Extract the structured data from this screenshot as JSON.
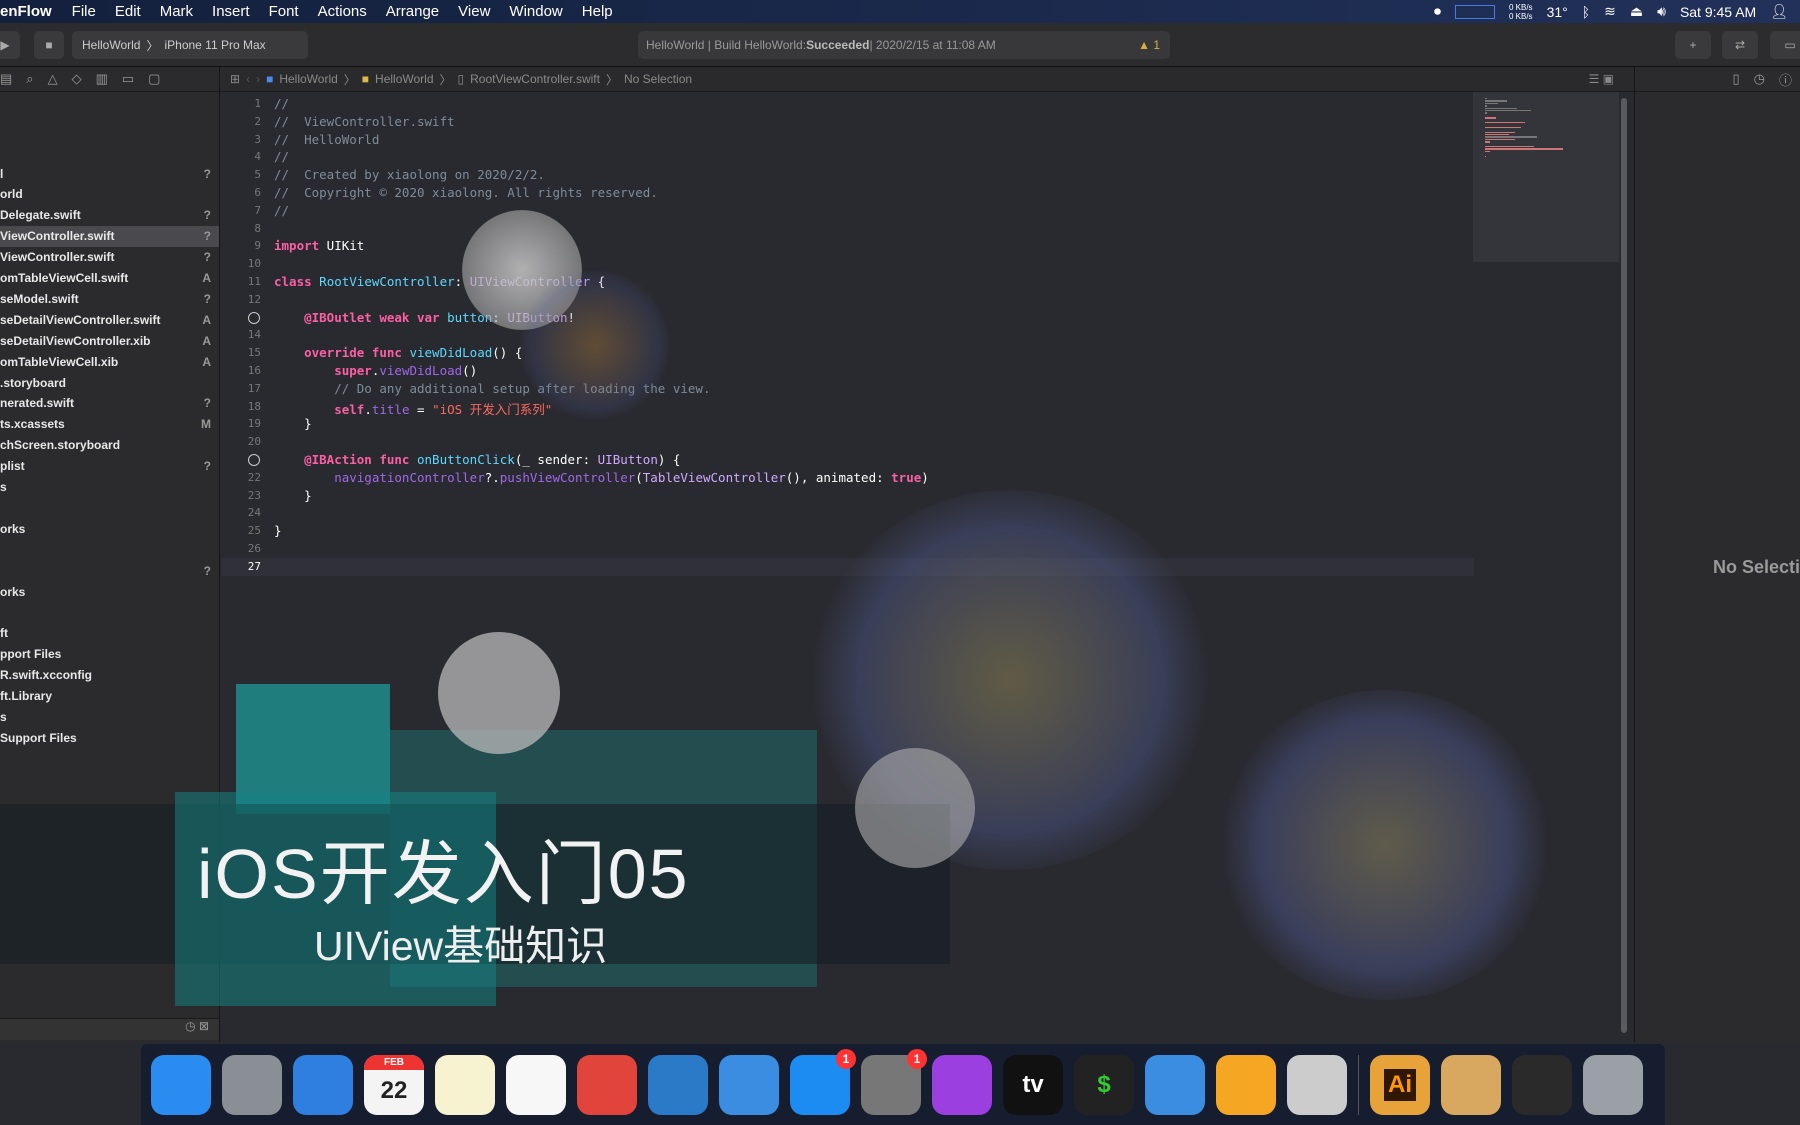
{
  "menubar": {
    "app": "enFlow",
    "items": [
      "File",
      "Edit",
      "Mark",
      "Insert",
      "Font",
      "Actions",
      "Arrange",
      "View",
      "Window",
      "Help"
    ],
    "status": {
      "net_up": "0 KB/s",
      "net_down": "0 KB/s",
      "temp": "31°",
      "clock": "Sat 9:45 AM"
    }
  },
  "toolbar": {
    "scheme": "HelloWorld",
    "device": "iPhone 11 Pro Max",
    "activity_prefix": "HelloWorld | Build HelloWorld: ",
    "activity_status": "Succeeded",
    "activity_suffix": " | 2020/2/15 at 11:08 AM",
    "warnings": "1"
  },
  "breadcrumb": [
    "HelloWorld",
    "HelloWorld",
    "RootViewController.swift",
    "No Selection"
  ],
  "navigator": {
    "files": [
      {
        "name": "l",
        "status": "?"
      },
      {
        "name": "orld",
        "status": ""
      },
      {
        "name": "Delegate.swift",
        "status": "?"
      },
      {
        "name": "ViewController.swift",
        "status": "?",
        "selected": true
      },
      {
        "name": "ViewController.swift",
        "status": "?"
      },
      {
        "name": "omTableViewCell.swift",
        "status": "A"
      },
      {
        "name": "seModel.swift",
        "status": "?"
      },
      {
        "name": "seDetailViewController.swift",
        "status": "A"
      },
      {
        "name": "seDetailViewController.xib",
        "status": "A"
      },
      {
        "name": "omTableViewCell.xib",
        "status": "A"
      },
      {
        "name": ".storyboard",
        "status": ""
      },
      {
        "name": "nerated.swift",
        "status": "?"
      },
      {
        "name": "ts.xcassets",
        "status": "M"
      },
      {
        "name": "chScreen.storyboard",
        "status": ""
      },
      {
        "name": "plist",
        "status": "?"
      },
      {
        "name": "s",
        "status": ""
      },
      {
        "name": "",
        "status": ""
      },
      {
        "name": "orks",
        "status": ""
      },
      {
        "name": "",
        "status": ""
      },
      {
        "name": "",
        "status": "?"
      },
      {
        "name": "orks",
        "status": ""
      },
      {
        "name": "",
        "status": ""
      },
      {
        "name": "ft",
        "status": ""
      },
      {
        "name": "pport Files",
        "status": ""
      },
      {
        "name": "R.swift.xcconfig",
        "status": ""
      },
      {
        "name": "ft.Library",
        "status": ""
      },
      {
        "name": "s",
        "status": ""
      },
      {
        "name": " Support Files",
        "status": ""
      }
    ]
  },
  "editor": {
    "current_line": 27,
    "breakpoint_lines": [
      13,
      21
    ],
    "lines": [
      [
        [
          "//",
          "comment"
        ]
      ],
      [
        [
          "//  ViewController.swift",
          "comment"
        ]
      ],
      [
        [
          "//  HelloWorld",
          "comment"
        ]
      ],
      [
        [
          "//",
          "comment"
        ]
      ],
      [
        [
          "//  Created by xiaolong on 2020/2/2.",
          "comment"
        ]
      ],
      [
        [
          "//  Copyright © 2020 xiaolong. All rights reserved.",
          "comment"
        ]
      ],
      [
        [
          "//",
          "comment"
        ]
      ],
      [],
      [
        [
          "import",
          "kw"
        ],
        [
          " UIKit",
          "plain"
        ]
      ],
      [],
      [
        [
          "class",
          "kw"
        ],
        [
          " ",
          "plain"
        ],
        [
          "RootViewController",
          "decl"
        ],
        [
          ": ",
          "plain"
        ],
        [
          "UIViewController",
          "type"
        ],
        [
          " {",
          "plain"
        ]
      ],
      [],
      [
        [
          "    @IBOutlet weak var",
          "kw"
        ],
        [
          " ",
          "plain"
        ],
        [
          "button",
          "decl"
        ],
        [
          ": ",
          "plain"
        ],
        [
          "UIButton",
          "type"
        ],
        [
          "!",
          "plain"
        ]
      ],
      [],
      [
        [
          "    override func",
          "kw"
        ],
        [
          " ",
          "plain"
        ],
        [
          "viewDidLoad",
          "decl"
        ],
        [
          "() {",
          "plain"
        ]
      ],
      [
        [
          "        super",
          "kw"
        ],
        [
          ".",
          "plain"
        ],
        [
          "viewDidLoad",
          "purple"
        ],
        [
          "()",
          "plain"
        ]
      ],
      [
        [
          "        // Do any additional setup after loading the view.",
          "comment"
        ]
      ],
      [
        [
          "        self",
          "kw"
        ],
        [
          ".",
          "plain"
        ],
        [
          "title",
          "purple"
        ],
        [
          " = ",
          "plain"
        ],
        [
          "\"iOS 开发入门系列\"",
          "str"
        ]
      ],
      [
        [
          "    }",
          "plain"
        ]
      ],
      [],
      [
        [
          "    @IBAction func",
          "kw"
        ],
        [
          " ",
          "plain"
        ],
        [
          "onButtonClick",
          "decl"
        ],
        [
          "(_ sender: ",
          "plain"
        ],
        [
          "UIButton",
          "type"
        ],
        [
          ") {",
          "plain"
        ]
      ],
      [
        [
          "        navigationController",
          "purple"
        ],
        [
          "?.",
          "plain"
        ],
        [
          "pushViewController",
          "purple"
        ],
        [
          "(",
          "plain"
        ],
        [
          "TableViewController",
          "type"
        ],
        [
          "(), animated: ",
          "plain"
        ],
        [
          "true",
          "kw"
        ],
        [
          ")",
          "plain"
        ]
      ],
      [
        [
          "    }",
          "plain"
        ]
      ],
      [],
      [
        [
          "}",
          "plain"
        ]
      ],
      [],
      []
    ]
  },
  "inspector": {
    "empty_label": "No Selection"
  },
  "overlay": {
    "title": "iOS开发入门05",
    "subtitle": "UIView基础知识"
  },
  "dock": [
    {
      "name": "Finder",
      "icon": "finder-icon",
      "color": "#2a8cf0"
    },
    {
      "name": "Launchpad",
      "icon": "rocket-icon",
      "color": "#8a8f96"
    },
    {
      "name": "Safari",
      "icon": "compass-icon",
      "color": "#2e7fe0"
    },
    {
      "name": "Calendar",
      "icon": "calendar-icon",
      "color": "#f4f4f4",
      "label": "22",
      "sub": "FEB"
    },
    {
      "name": "Notes",
      "icon": "notes-icon",
      "color": "#f7f2d0"
    },
    {
      "name": "Reminders",
      "icon": "list-icon",
      "color": "#f7f7f7"
    },
    {
      "name": "Chrome",
      "icon": "chrome-icon",
      "color": "#e0443a"
    },
    {
      "name": "VS Code",
      "icon": "vscode-icon",
      "color": "#2a7ac8"
    },
    {
      "name": "Xcode",
      "icon": "hammer-icon",
      "color": "#3a8de0"
    },
    {
      "name": "App Store",
      "icon": "appstore-icon",
      "color": "#1c8bf2",
      "badge": "1"
    },
    {
      "name": "System Preferences",
      "icon": "gear-icon",
      "color": "#777",
      "badge": "1"
    },
    {
      "name": "Podcasts",
      "icon": "podcast-icon",
      "color": "#9b3fe0"
    },
    {
      "name": "Apple TV",
      "icon": "tv-icon",
      "color": "#111",
      "label": "tv"
    },
    {
      "name": "Terminal",
      "icon": "terminal-icon",
      "color": "#222",
      "label": "$"
    },
    {
      "name": "Simulator",
      "icon": "simulator-icon",
      "color": "#3a8de0"
    },
    {
      "name": "Sketch",
      "icon": "sketch-icon",
      "color": "#f5a623"
    },
    {
      "name": "Video Editor",
      "icon": "film-icon",
      "color": "#ccc"
    },
    {
      "sep": true
    },
    {
      "name": "Illustrator Folder",
      "icon": "illustrator-icon",
      "color": "#e8a23a",
      "label": "Ai"
    },
    {
      "name": "Archive",
      "icon": "box-icon",
      "color": "#d8a860"
    },
    {
      "name": "Screenshot",
      "icon": "code-window-icon",
      "color": "#2a2a2a"
    },
    {
      "name": "Trash",
      "icon": "trash-icon",
      "color": "#9aa0a6"
    }
  ]
}
